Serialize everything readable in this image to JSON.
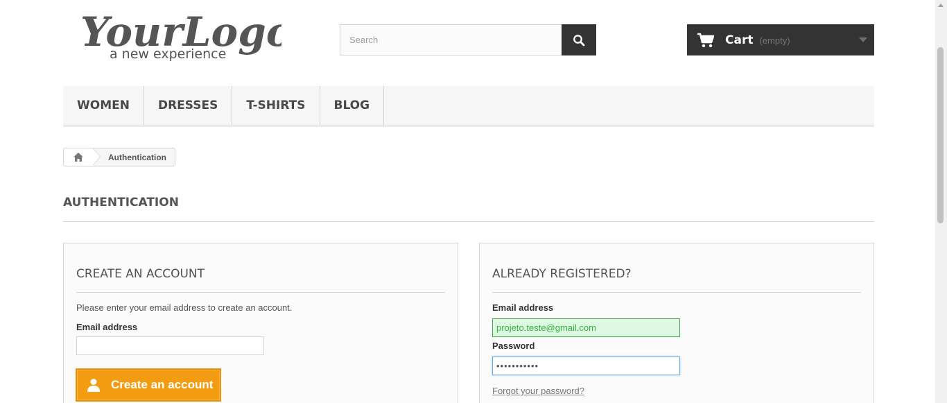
{
  "header": {
    "logo_text": "YourLogo",
    "logo_tagline": "a new experience",
    "search": {
      "placeholder": "Search",
      "value": ""
    },
    "cart": {
      "title": "Cart",
      "status": "(empty)"
    }
  },
  "menu": {
    "items": [
      {
        "label": "Women"
      },
      {
        "label": "Dresses"
      },
      {
        "label": "T-shirts"
      },
      {
        "label": "Blog"
      }
    ]
  },
  "breadcrumb": {
    "current": "Authentication"
  },
  "page": {
    "heading": "Authentication"
  },
  "create_account": {
    "title": "Create an account",
    "description": "Please enter your email address to create an account.",
    "email_label": "Email address",
    "email_value": "",
    "button_label": "Create an account"
  },
  "login": {
    "title": "Already registered?",
    "email_label": "Email address",
    "email_value": "projeto.teste@gmail.com",
    "password_label": "Password",
    "password_value": "•••••••••••",
    "forgot_link": "Forgot your password?"
  },
  "colors": {
    "accent": "#f39c11",
    "dark": "#333333",
    "valid_bg": "#ddf9e1",
    "valid_text": "#35b33f"
  }
}
